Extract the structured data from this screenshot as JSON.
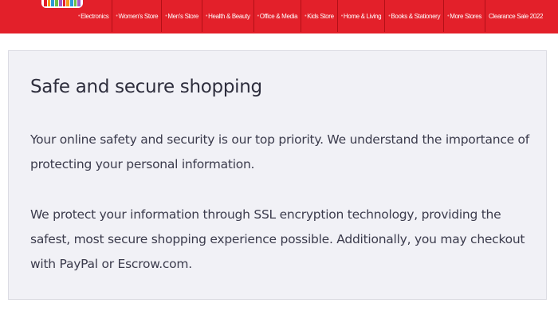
{
  "nav": {
    "items": [
      "Electronics",
      "Women's Store",
      "Men's Store",
      "Health & Beauty",
      "Office & Media",
      "Kids Store",
      "Home & Living",
      "Books & Stationery",
      "More Stores",
      "Clearance Sale 2022"
    ]
  },
  "colors": {
    "brand_red": "#e3202a",
    "card_background": "#f1f1f6"
  },
  "content": {
    "title": "Safe and secure shopping",
    "paragraph_1": "Your online safety and security is our top priority. We understand the importance of protecting your personal information.",
    "paragraph_2": "We protect your information through SSL encryption technology, providing the safest, most secure shopping experience possible. Additionally, you may checkout with PayPal or Escrow.com."
  }
}
